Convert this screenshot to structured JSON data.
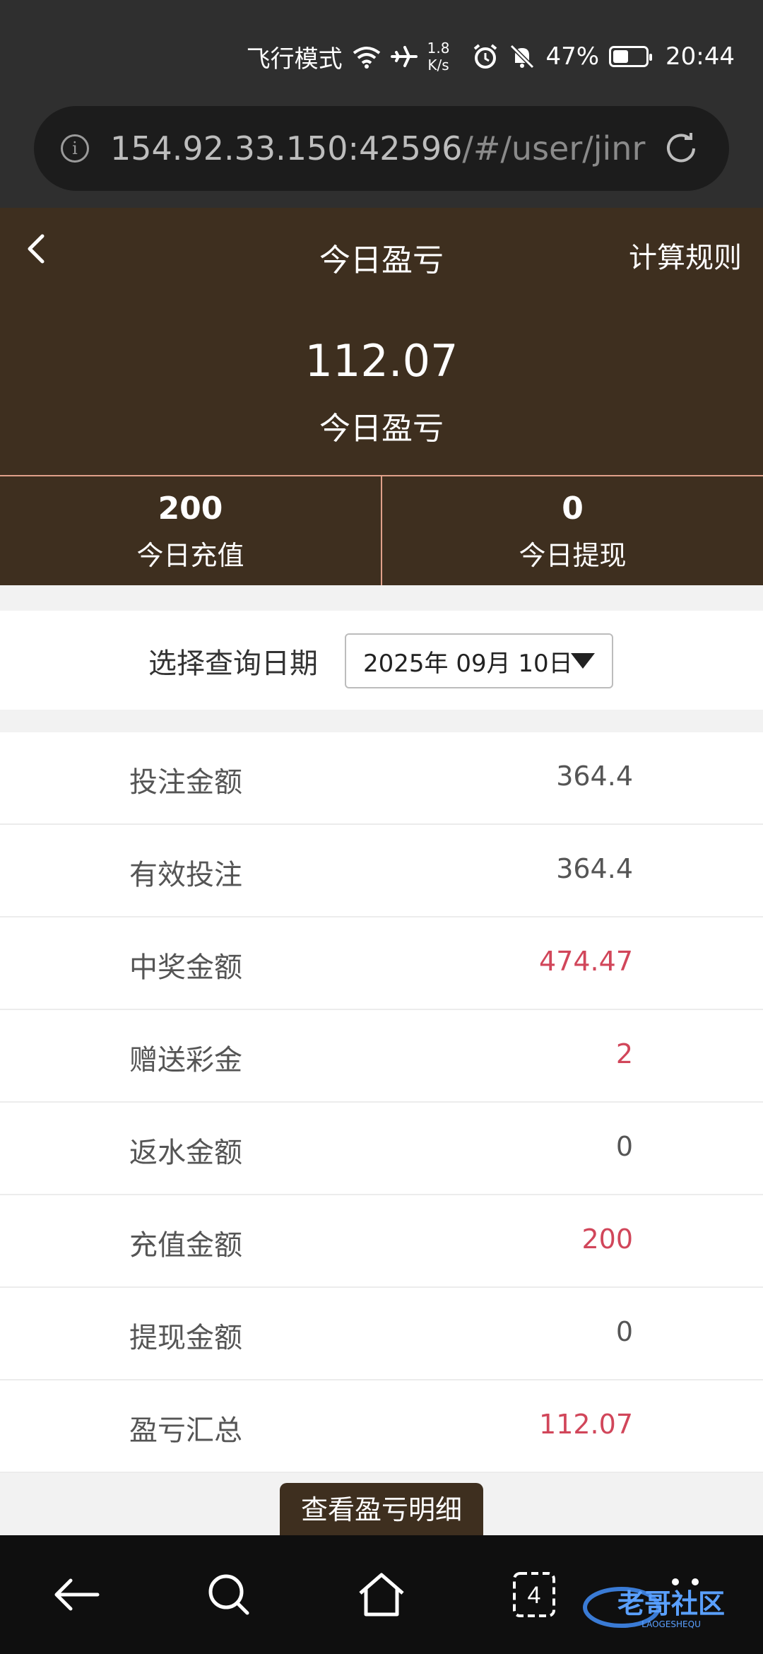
{
  "status_bar": {
    "airplane_mode_label": "飞行模式",
    "network_speed_value": "1.8",
    "network_speed_unit": "K/s",
    "battery_percent": "47%",
    "battery_level": 0.47,
    "time": "20:44",
    "icons": [
      "wifi-icon",
      "airplane-icon",
      "alarm-icon",
      "mute-icon",
      "battery-icon"
    ]
  },
  "browser": {
    "url_host": "154.92.33.150:42596",
    "url_path": "/#/user/jinriy"
  },
  "header": {
    "title": "今日盈亏",
    "rules_link": "计算规则",
    "today_profit_value": "112.07",
    "today_profit_label": "今日盈亏"
  },
  "stats": {
    "deposit_value": "200",
    "deposit_label": "今日充值",
    "withdraw_value": "0",
    "withdraw_label": "今日提现"
  },
  "date_query": {
    "label": "选择查询日期",
    "selected_date": "2025年 09月 10日"
  },
  "summary": [
    {
      "label": "投注金额",
      "value": "364.4",
      "highlight": false
    },
    {
      "label": "有效投注",
      "value": "364.4",
      "highlight": false
    },
    {
      "label": "中奖金额",
      "value": "474.47",
      "highlight": true
    },
    {
      "label": "赠送彩金",
      "value": "2",
      "highlight": true
    },
    {
      "label": "返水金额",
      "value": "0",
      "highlight": false
    },
    {
      "label": "充值金额",
      "value": "200",
      "highlight": true
    },
    {
      "label": "提现金额",
      "value": "0",
      "highlight": false
    },
    {
      "label": "盈亏汇总",
      "value": "112.07",
      "highlight": true
    }
  ],
  "detail_button": "查看盈亏明细",
  "nav": {
    "tab_count": "4"
  },
  "watermark": {
    "text": "老哥社区",
    "subtext": "LAOGESHEQU"
  },
  "colors": {
    "header_brown": "#3e2f1f",
    "highlight_red": "#d1465a",
    "divider_salmon": "#e0a08a"
  }
}
